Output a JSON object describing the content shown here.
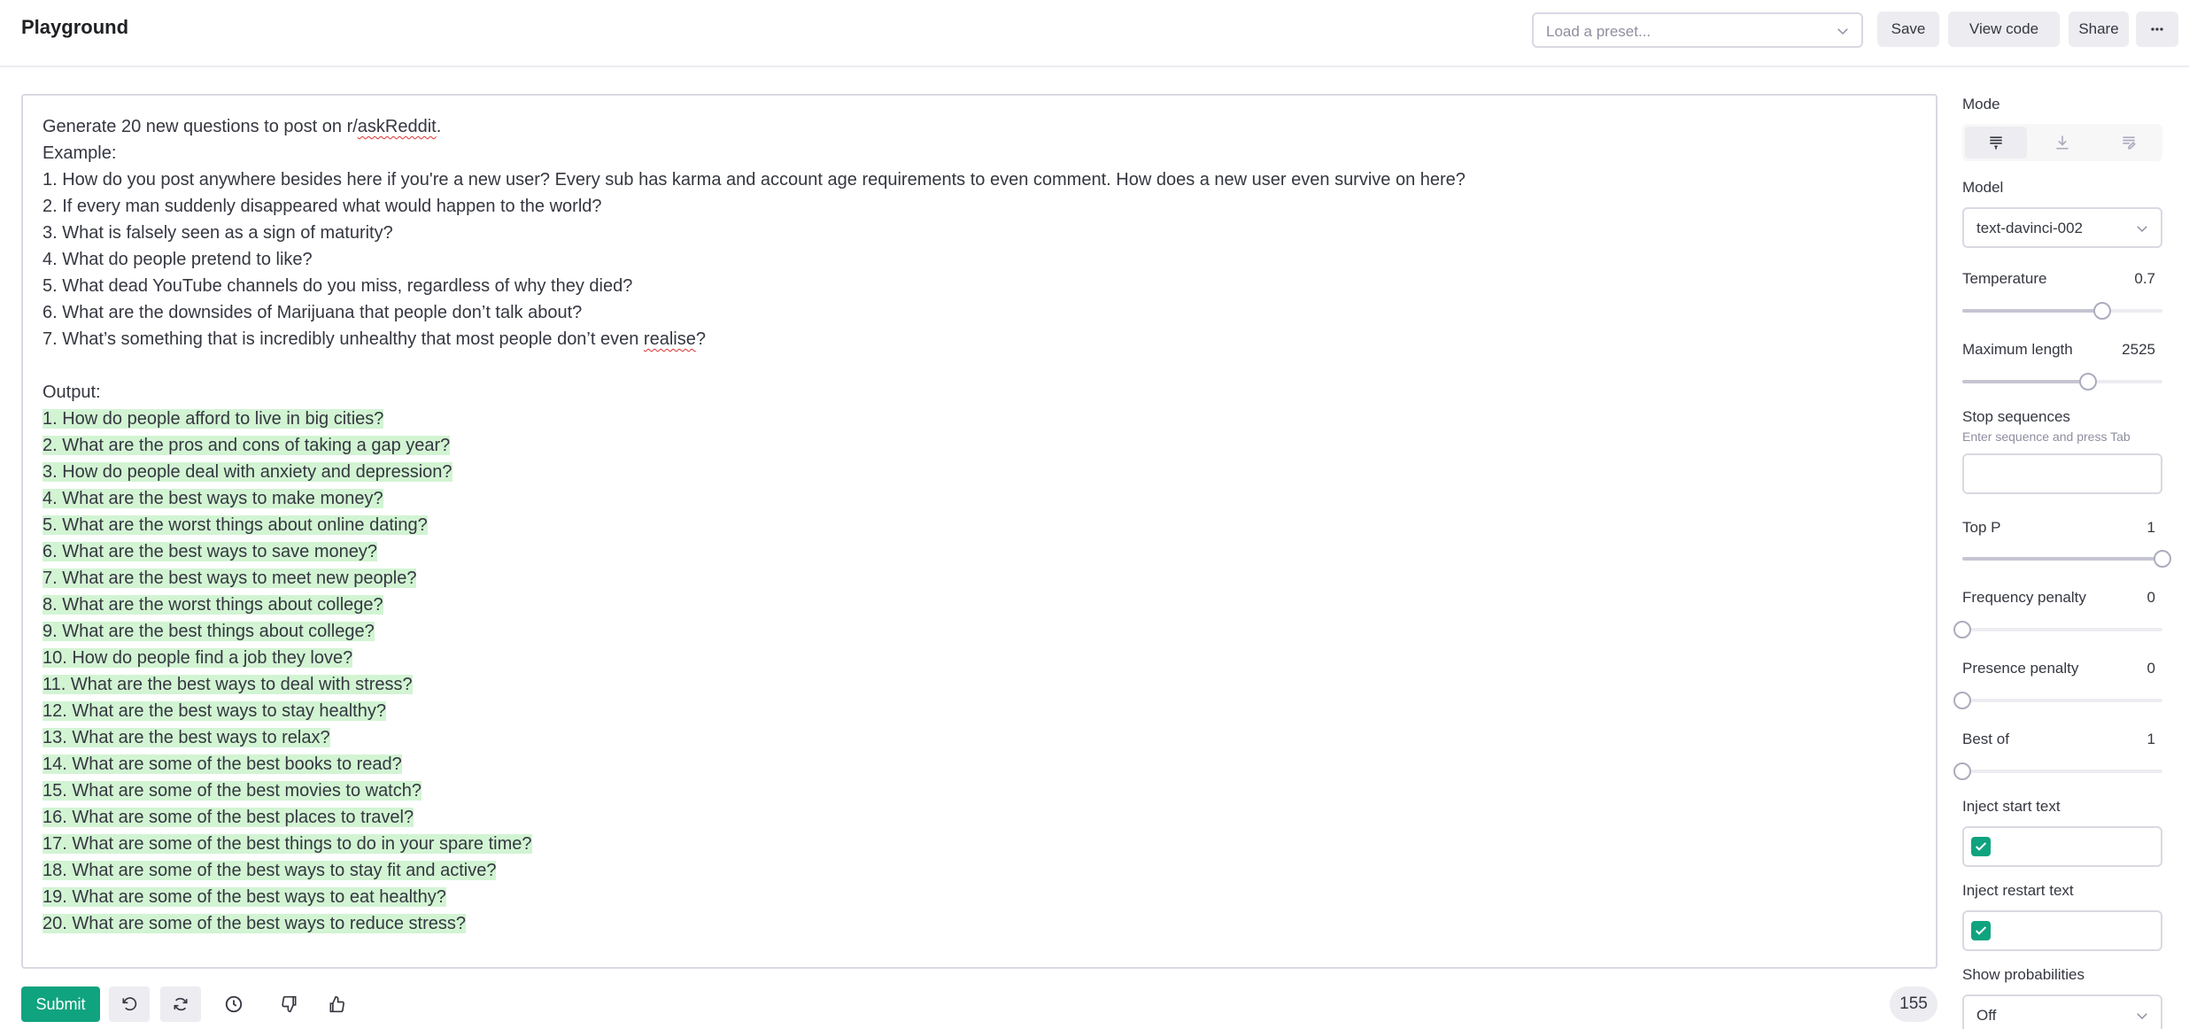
{
  "header": {
    "title": "Playground",
    "preset_placeholder": "Load a preset...",
    "save_label": "Save",
    "view_code_label": "View code",
    "share_label": "Share",
    "more_label": "..."
  },
  "editor": {
    "prompt_lines": [
      "Generate 20 new questions to post on r/askReddit.",
      "Example:",
      "1. How do you post anywhere besides here if you're a new user? Every sub has karma and account age requirements to even comment. How does a new user even survive on here?",
      "2. If every man suddenly disappeared what would happen to the world?",
      "3. What is falsely seen as a sign of maturity?",
      "4. What do people pretend to like?",
      "5. What dead YouTube channels do you miss, regardless of why they died?",
      "6. What are the downsides of Marijuana that people don’t talk about?",
      "7. What’s something that is incredibly unhealthy that most people don’t even realise?",
      "",
      "Output:"
    ],
    "output_lines": [
      "1. How do people afford to live in big cities?",
      "2. What are the pros and cons of taking a gap year?",
      "3. How do people deal with anxiety and depression?",
      "4. What are the best ways to make money?",
      "5. What are the worst things about online dating?",
      "6. What are the best ways to save money?",
      "7. What are the best ways to meet new people?",
      "8. What are the worst things about college?",
      "9. What are the best things about college?",
      "10. How do people find a job they love?",
      "11. What are the best ways to deal with stress?",
      "12. What are the best ways to stay healthy?",
      "13. What are the best ways to relax?",
      "14. What are some of the best books to read?",
      "15. What are some of the best movies to watch?",
      "16. What are some of the best places to travel?",
      "17. What are some of the best things to do in your spare time?",
      "18. What are some of the best ways to stay fit and active?",
      "19. What are some of the best ways to eat healthy?",
      "20. What are some of the best ways to reduce stress?"
    ]
  },
  "bottom": {
    "submit_label": "Submit",
    "token_count": "155",
    "tools": [
      "undo-icon",
      "regenerate-icon",
      "history-icon",
      "thumbs-down-icon",
      "thumbs-up-icon"
    ]
  },
  "sidebar": {
    "mode_label": "Mode",
    "modes": [
      "complete-icon",
      "insert-icon",
      "edit-icon"
    ],
    "active_mode": "complete-icon",
    "model_label": "Model",
    "model_value": "text-davinci-002",
    "temperature": {
      "label": "Temperature",
      "value": "0.7",
      "level": 0.7
    },
    "max_length": {
      "label": "Maximum length",
      "value": "2525",
      "level": 0.63
    },
    "stop_sequences": {
      "label": "Stop sequences",
      "hint": "Enter sequence and press Tab"
    },
    "top_p": {
      "label": "Top P",
      "value": "1",
      "level": 1
    },
    "frequency_penalty": {
      "label": "Frequency penalty",
      "value": "0",
      "level": 0
    },
    "presence_penalty": {
      "label": "Presence penalty",
      "value": "0",
      "level": 0
    },
    "best_of": {
      "label": "Best of",
      "value": "1",
      "level": 0
    },
    "inject_start": {
      "label": "Inject start text",
      "checked": true
    },
    "inject_restart": {
      "label": "Inject restart text",
      "checked": true
    },
    "show_probabilities": {
      "label": "Show probabilities",
      "value": "Off"
    }
  },
  "colors": {
    "accent": "#10a37f",
    "highlight": "#d2f4d3",
    "button_bg": "#ececf1",
    "border": "#d9d9e3"
  }
}
